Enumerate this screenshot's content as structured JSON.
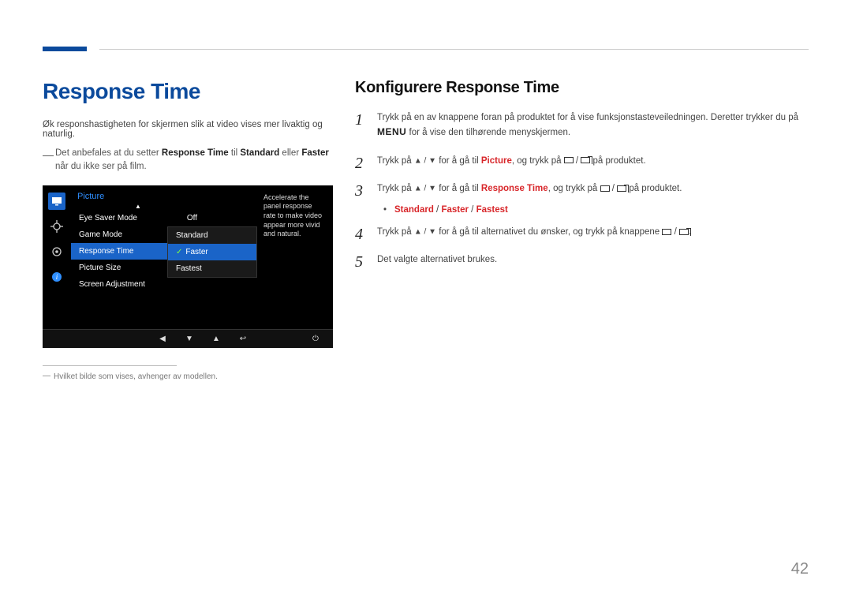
{
  "page_number": "42",
  "left": {
    "heading": "Response Time",
    "intro": "Øk responshastigheten for skjermen slik at video vises mer livaktig og naturlig.",
    "note_prefix": "Det anbefales at du setter ",
    "note_b1": "Response Time",
    "note_mid1": " til ",
    "note_b2": "Standard",
    "note_mid2": " eller ",
    "note_b3": "Faster",
    "note_suffix": " når du ikke ser på film.",
    "footnote": "Hvilket bilde som vises, avhenger av modellen."
  },
  "osd": {
    "title": "Picture",
    "items": [
      {
        "label": "Eye Saver Mode",
        "value": "Off"
      },
      {
        "label": "Game Mode"
      },
      {
        "label": "Response Time"
      },
      {
        "label": "Picture Size"
      },
      {
        "label": "Screen Adjustment"
      }
    ],
    "submenu": [
      "Standard",
      "Faster",
      "Fastest"
    ],
    "desc": "Accelerate the panel response rate to make video appear more vivid and natural."
  },
  "right": {
    "heading": "Konfigurere Response Time",
    "step1_a": "Trykk på en av knappene foran på produktet for å vise funksjonstasteveiledningen. Deretter trykker du på ",
    "step1_menu": "MENU",
    "step1_b": " for å vise den tilhørende menyskjermen.",
    "step2_a": "Trykk på ",
    "step2_b": " for å gå til ",
    "step2_picture": "Picture",
    "step2_c": ", og trykk på ",
    "step2_d": " på produktet.",
    "step3_a": "Trykk på ",
    "step3_b": " for å gå til ",
    "step3_rt": "Response Time",
    "step3_c": ", og trykk på ",
    "step3_d": " på produktet.",
    "options_a": "Standard",
    "options_sep": " / ",
    "options_b": "Faster",
    "options_c": "Fastest",
    "step4_a": "Trykk på ",
    "step4_b": " for å gå til alternativet du ønsker, og trykk på knappene ",
    "step4_c": ".",
    "step5": "Det valgte alternativet brukes."
  }
}
